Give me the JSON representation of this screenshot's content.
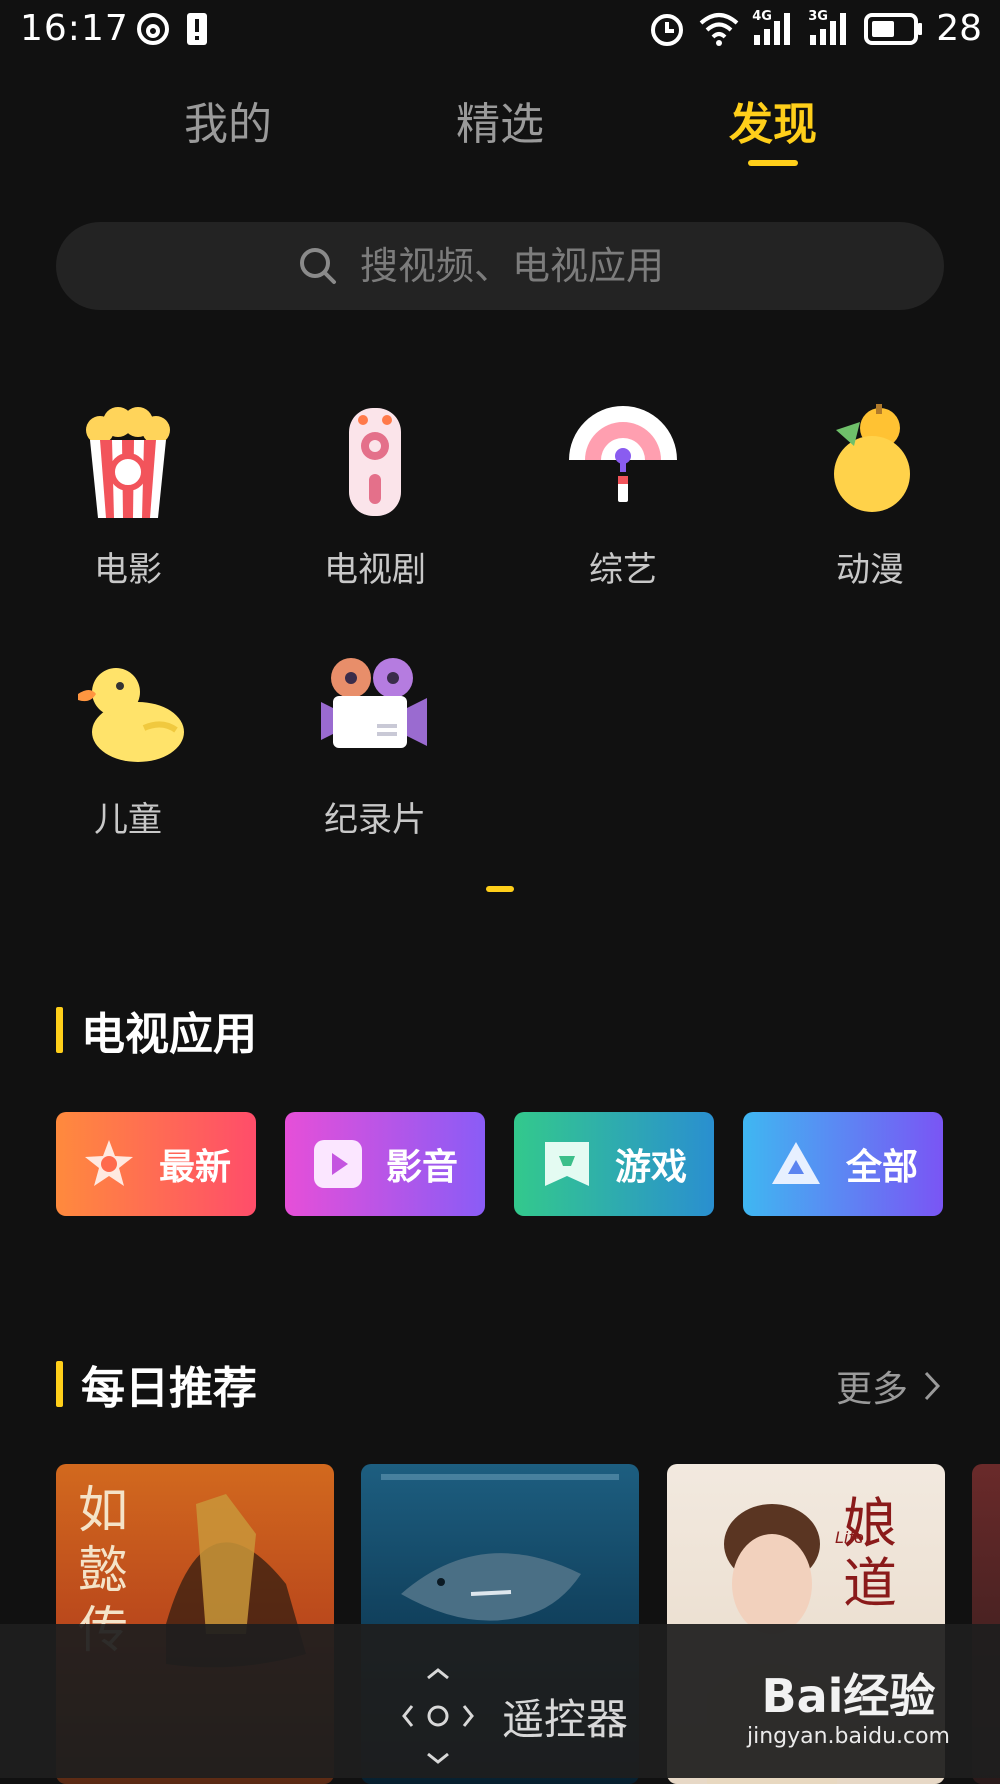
{
  "status_bar": {
    "time": "16:17",
    "network_4g": "4G",
    "network_3g": "3G",
    "battery": "28"
  },
  "tabs": [
    {
      "label": "我的",
      "active": false
    },
    {
      "label": "精选",
      "active": false
    },
    {
      "label": "发现",
      "active": true
    }
  ],
  "search": {
    "placeholder": "搜视频、电视应用"
  },
  "categories": [
    {
      "label": "电影",
      "icon": "popcorn-icon"
    },
    {
      "label": "电视剧",
      "icon": "remote-icon"
    },
    {
      "label": "综艺",
      "icon": "fan-icon"
    },
    {
      "label": "动漫",
      "icon": "gourd-icon"
    },
    {
      "label": "儿童",
      "icon": "duck-icon"
    },
    {
      "label": "纪录片",
      "icon": "film-camera-icon"
    }
  ],
  "tv_apps": {
    "title": "电视应用",
    "buttons": [
      {
        "label": "最新",
        "icon": "star-icon"
      },
      {
        "label": "影音",
        "icon": "play-icon"
      },
      {
        "label": "游戏",
        "icon": "game-icon"
      },
      {
        "label": "全部",
        "icon": "triangle-icon"
      }
    ]
  },
  "daily": {
    "title": "每日推荐",
    "more_label": "更多",
    "posters": [
      {
        "title_text": "如懿传"
      },
      {
        "title_text": ""
      },
      {
        "title_text": "娘道",
        "subtitle_text": "Life"
      }
    ]
  },
  "remote": {
    "label": "遥控器"
  },
  "watermark": {
    "logo": "Bai经验",
    "url": "jingyan.baidu.com"
  },
  "colors": {
    "accent": "#ffcf1a",
    "background": "#111111"
  }
}
